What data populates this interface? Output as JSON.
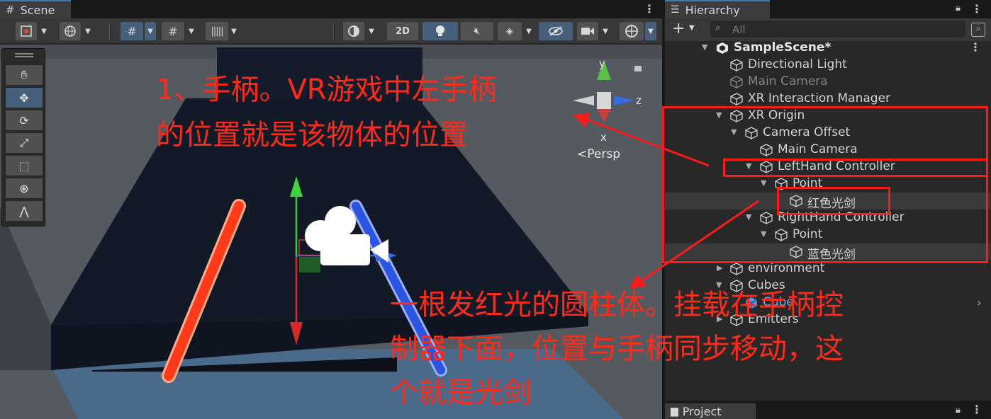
{
  "scene": {
    "tab_label": "Scene",
    "btn_2d": "2D",
    "gizmo": {
      "y_label": "y",
      "z_label": "z",
      "x_label": "x",
      "persp_label": "Persp"
    }
  },
  "hierarchy": {
    "tab_label": "Hierarchy",
    "search_placeholder": "All",
    "items": [
      {
        "label": "SampleScene*"
      },
      {
        "label": "Directional Light"
      },
      {
        "label": "Main Camera"
      },
      {
        "label": "XR Interaction Manager"
      },
      {
        "label": "XR Origin"
      },
      {
        "label": "Camera Offset"
      },
      {
        "label": "Main Camera"
      },
      {
        "label": "LeftHand Controller"
      },
      {
        "label": "Point"
      },
      {
        "label": "红色光剑"
      },
      {
        "label": "RightHand Controller"
      },
      {
        "label": "Point"
      },
      {
        "label": "蓝色光剑"
      },
      {
        "label": "environment"
      },
      {
        "label": "Cubes"
      },
      {
        "label": "Cube"
      },
      {
        "label": "Emitters"
      }
    ]
  },
  "project_tab": {
    "label": "Project"
  },
  "annotations": {
    "note1_line1": "1、手柄。VR游戏中左手柄",
    "note1_line2": "的位置就是该物体的位置",
    "note2_line1": "一根发红光的圆柱体。挂载在手柄控",
    "note2_line2": "制器下面，位置与手柄同步移动，这",
    "note2_line3": "个就是光剑"
  },
  "colors": {
    "accent_blue": "#46607c",
    "annotation_red": "#ff2a1a",
    "red_saber": "#ff3a1a",
    "blue_saber": "#2a55e0"
  }
}
